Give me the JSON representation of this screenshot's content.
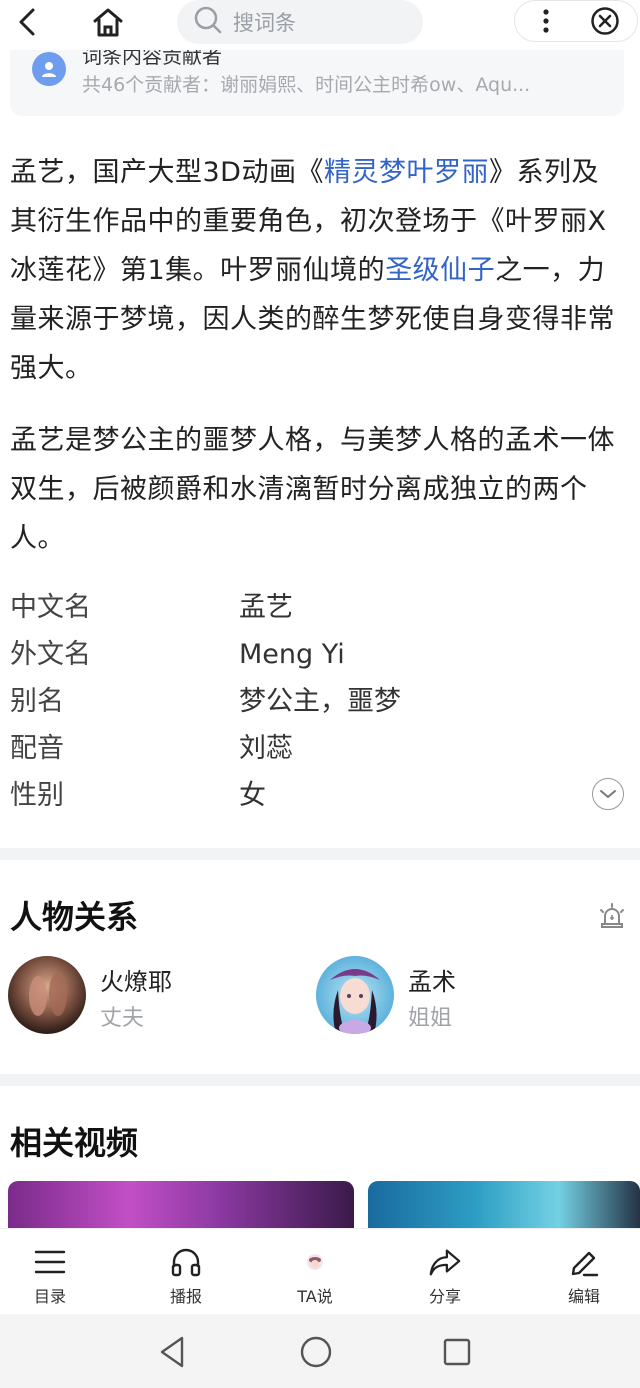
{
  "topbar": {
    "search_placeholder": "搜词条",
    "icons": [
      "back-icon",
      "home-icon",
      "search-icon",
      "more-vertical-icon",
      "close-circle-icon"
    ]
  },
  "contributors": {
    "title": "词条内容贡献者",
    "summary": "共46个贡献者：谢丽娟熙、时间公主时希ow、Aqu..."
  },
  "intro": {
    "p1": {
      "t1": "孟艺，国产大型3D动画《",
      "link1": "精灵梦叶罗丽",
      "t2": "》系列及其衍生作品中的重要角色，初次登场于《叶罗丽X冰莲花》第1集。叶罗丽仙境的",
      "link2": "圣级仙子",
      "t3": "之一，力量来源于梦境，因人类的醉生梦死使自身变得非常强大。"
    },
    "p2": "孟艺是梦公主的噩梦人格，与美梦人格的孟术一体双生，后被颜爵和水清漓暂时分离成独立的两个人。"
  },
  "info": [
    {
      "key": "中文名",
      "value": "孟艺"
    },
    {
      "key": "外文名",
      "value": "Meng Yi"
    },
    {
      "key": "别名",
      "value": "梦公主，噩梦"
    },
    {
      "key": "配音",
      "value": "刘蕊"
    },
    {
      "key": "性别",
      "value": "女"
    }
  ],
  "relations": {
    "title": "人物关系",
    "items": [
      {
        "name": "火燎耶",
        "role": "丈夫"
      },
      {
        "name": "孟术",
        "role": "姐姐"
      }
    ]
  },
  "videos": {
    "title": "相关视频"
  },
  "toolbar": {
    "items": [
      {
        "label": "目录",
        "icon": "list-icon"
      },
      {
        "label": "播报",
        "icon": "headphones-icon"
      },
      {
        "label": "TA说",
        "icon": "ta-avatar-icon"
      },
      {
        "label": "分享",
        "icon": "share-icon"
      },
      {
        "label": "编辑",
        "icon": "edit-icon"
      }
    ]
  },
  "colors": {
    "link": "#3264c8",
    "divider": "#f2f3f5",
    "muted": "#a0a3a8"
  }
}
